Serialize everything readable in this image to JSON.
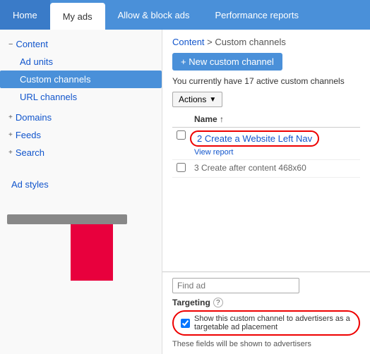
{
  "nav": {
    "items": [
      {
        "label": "Home",
        "active": false
      },
      {
        "label": "My ads",
        "active": true
      },
      {
        "label": "Allow & block ads",
        "active": false
      },
      {
        "label": "Performance reports",
        "active": false
      }
    ]
  },
  "sidebar": {
    "content_label": "Content",
    "items": [
      {
        "label": "Ad units",
        "indent": true,
        "active": false
      },
      {
        "label": "Custom channels",
        "indent": true,
        "active": true
      },
      {
        "label": "URL channels",
        "indent": true,
        "active": false
      }
    ],
    "sections": [
      {
        "label": "Domains",
        "expanded": false
      },
      {
        "label": "Feeds",
        "expanded": false
      },
      {
        "label": "Search",
        "expanded": false
      }
    ],
    "ad_styles_label": "Ad styles"
  },
  "content": {
    "breadcrumb": "Content > Custom channels",
    "breadcrumb_link": "Content",
    "breadcrumb_current": "Custom channels",
    "new_button_label": "+ New custom channel",
    "info_text": "You currently have 17 active custom channels",
    "actions_label": "Actions",
    "table": {
      "columns": [
        "Name ↑"
      ],
      "rows": [
        {
          "name": "2 Create a Website Left Nav",
          "view_report": "View report"
        },
        {
          "name": "3 Create after content 468x60",
          "view_report": ""
        }
      ]
    }
  },
  "bottom": {
    "find_ad_placeholder": "Find ad",
    "targeting_label": "Targeting",
    "help_title": "?",
    "checkbox_label": "Show this custom channel to advertisers as a targetable ad placement",
    "note_text": "These fields will be shown to advertisers"
  },
  "visuals": {
    "gray_bar_color": "#888888",
    "red_bar_color": "#e8003d",
    "oval_color": "#dd0000"
  }
}
